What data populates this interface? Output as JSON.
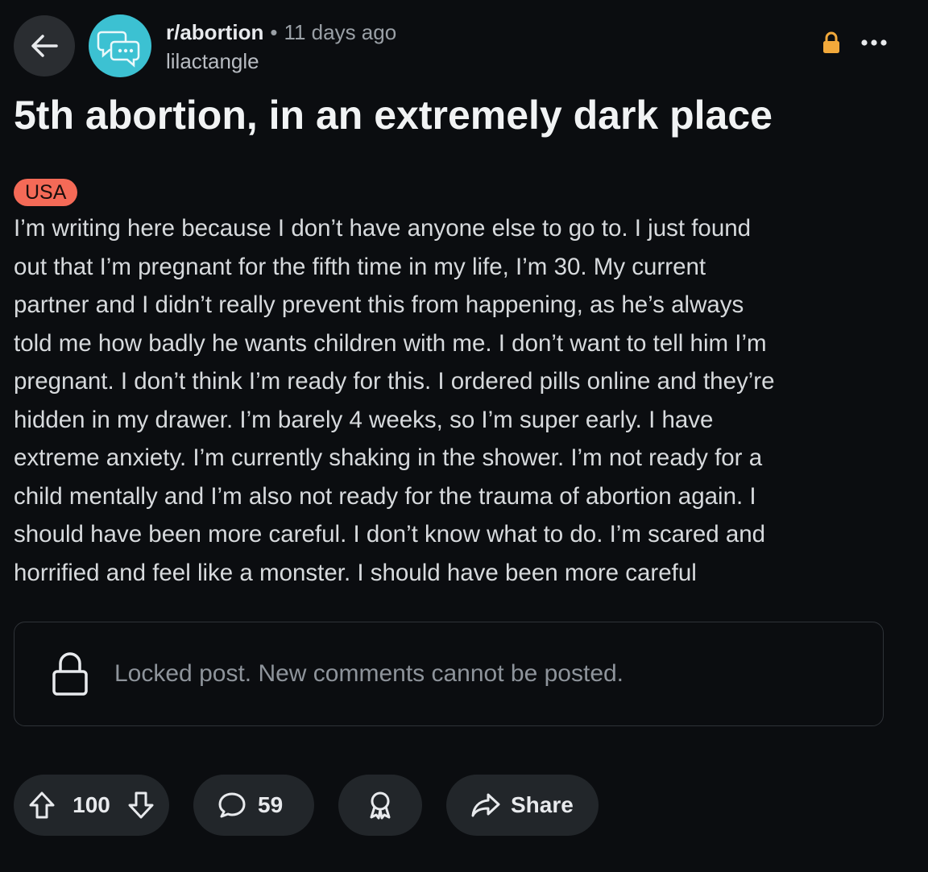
{
  "header": {
    "subreddit": "r/abortion",
    "separator": "•",
    "time_ago": "11 days ago",
    "author": "lilactangle",
    "back_icon": "arrow-left-icon",
    "lock_icon": "lock-icon",
    "more_icon": "ellipsis-icon"
  },
  "post": {
    "title": "5th abortion, in an extremely dark place",
    "flair": "USA",
    "body_lines": [
      "I’m writing here because I don’t have anyone else to go to. I just found",
      "out that I’m pregnant for the fifth time in my life, I’m 30. My current",
      "partner and I didn’t really prevent this from happening, as he’s always",
      "told me how badly he wants children with me. I don’t want to tell him I’m",
      "pregnant. I don’t think I’m ready for this. I ordered pills online and they’re",
      "hidden in my drawer. I’m barely 4 weeks, so I’m super early. I have",
      "extreme anxiety. I’m currently shaking in the shower. I’m not ready for a",
      "child mentally and I’m also not ready for the trauma of abortion again. I",
      "should have been more careful. I don’t know what to do. I’m scared and",
      "horrified and feel like a monster. I should have been more careful"
    ]
  },
  "locked_notice": {
    "text": "Locked post. New comments cannot be posted."
  },
  "actions": {
    "votes": "100",
    "comments": "59",
    "share_label": "Share"
  },
  "colors": {
    "background": "#0b0d10",
    "flair": "#f46a57",
    "avatar": "#3cc1d2",
    "lock_badge": "#f2a93b",
    "pill": "#22262a"
  }
}
